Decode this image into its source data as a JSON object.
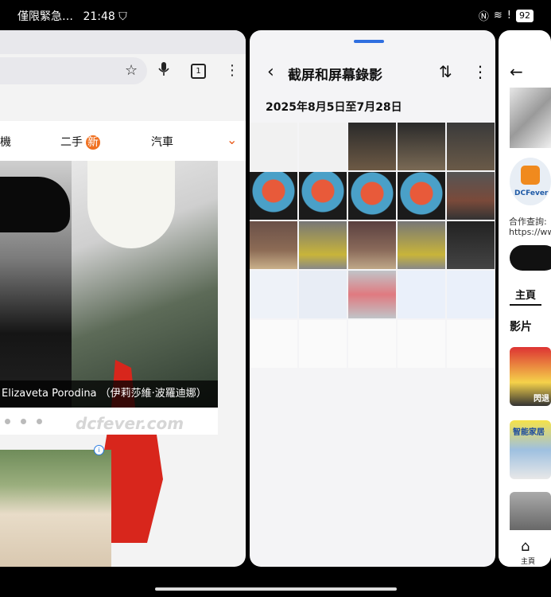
{
  "status": {
    "carrier": "僅限緊急…",
    "time": "21:48",
    "battery": "92"
  },
  "browser": {
    "nav_items": [
      "機",
      "二手",
      "汽車"
    ],
    "new_badge": "新",
    "tab_count": "1",
    "photo_caption": "Elizaveta Porodina （伊莉莎維·波羅迪娜）",
    "watermark": "dcfever.com",
    "ad_info": "i"
  },
  "gallery": {
    "title": "截屏和屏幕錄影",
    "date_range": "2025年8月5日至7月28日"
  },
  "right_panel": {
    "logo_text": "DCFever",
    "contact_label": "合作查詢:",
    "url_text": "https://www",
    "tab_home": "主頁",
    "section_video": "影片",
    "thumb_text_1": "閃退",
    "thumb_text_2": "智能家居",
    "bottom_home_label": "主頁"
  },
  "icons": {
    "back": "back-arrow-icon",
    "sort": "sort-icon",
    "more": "more-vert-icon",
    "star": "star-icon",
    "mic": "mic-icon",
    "home": "home-icon"
  }
}
